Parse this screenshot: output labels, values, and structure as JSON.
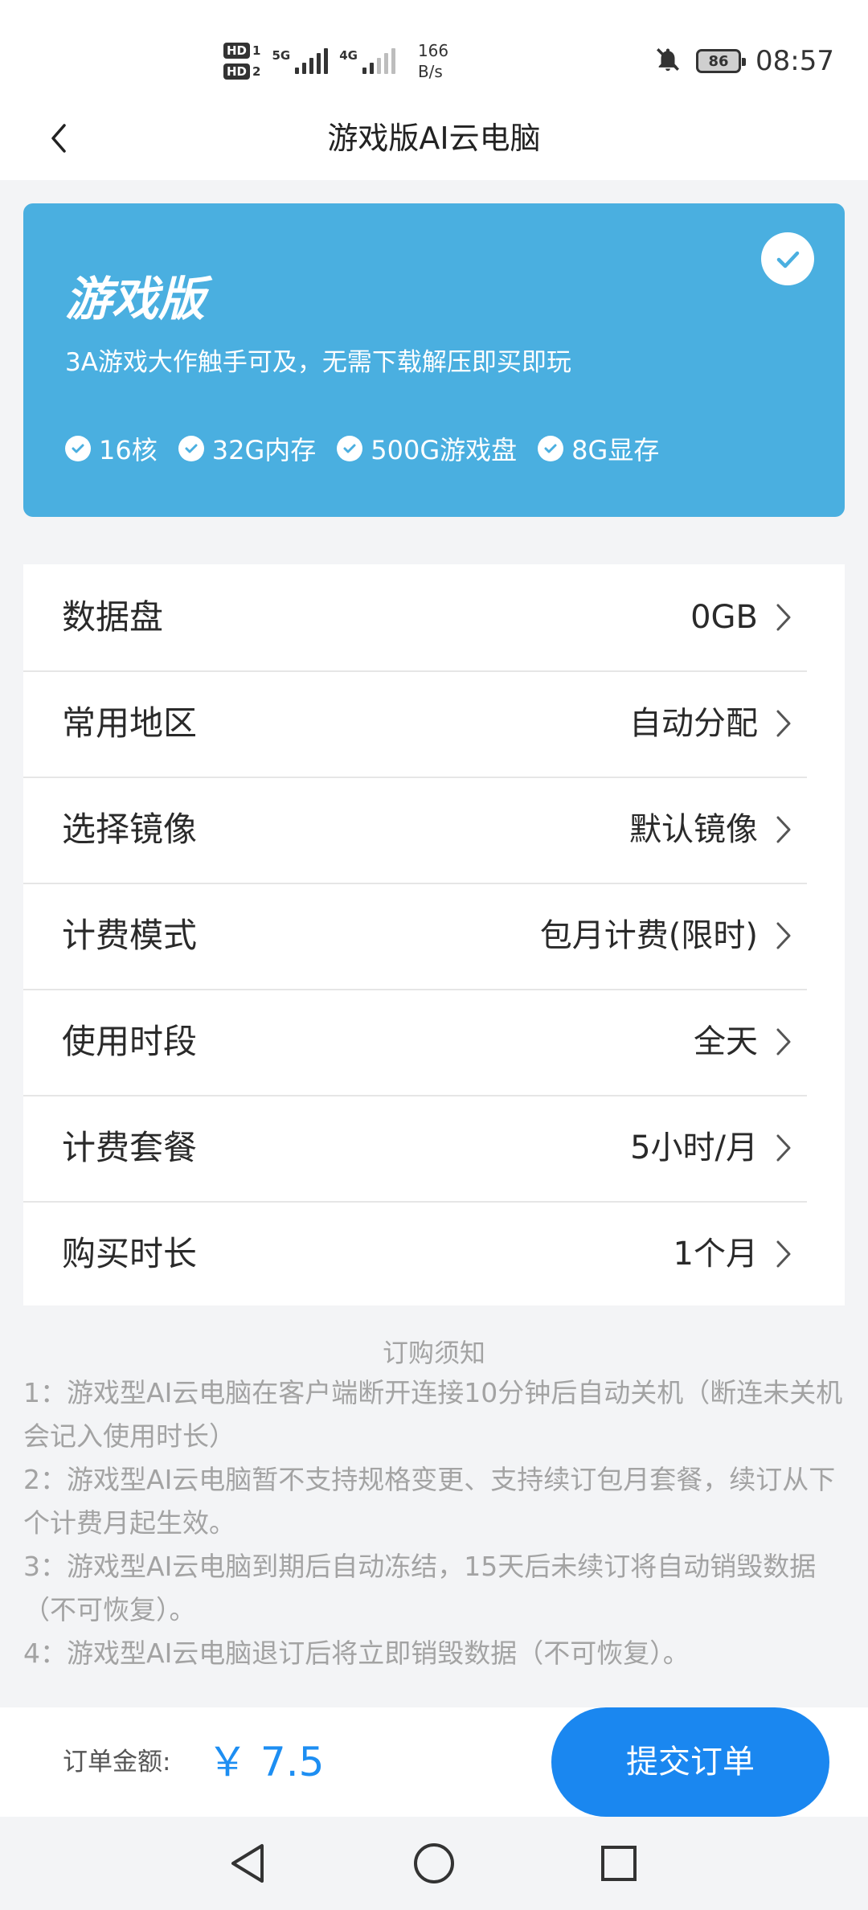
{
  "status_bar": {
    "hd1": "HD",
    "hd1_num": "1",
    "hd2": "HD",
    "hd2_num": "2",
    "sig1_label": "5G",
    "sig2_label": "4G",
    "net_speed_value": "166",
    "net_speed_unit": "B/s",
    "battery": "86",
    "time": "08:57",
    "icons": [
      "bell-off-icon",
      "battery-icon"
    ]
  },
  "header": {
    "back_icon": "chevron-left-icon",
    "title": "游戏版AI云电脑"
  },
  "plan": {
    "name": "游戏版",
    "description": "3A游戏大作触手可及，无需下载解压即买即玩",
    "selected": true,
    "features": [
      "16核",
      "32G内存",
      "500G游戏盘",
      "8G显存"
    ],
    "color": "#4aafe0"
  },
  "settings": [
    {
      "label": "数据盘",
      "value": "0GB"
    },
    {
      "label": "常用地区",
      "value": "自动分配"
    },
    {
      "label": "选择镜像",
      "value": "默认镜像"
    },
    {
      "label": "计费模式",
      "value": "包月计费(限时)"
    },
    {
      "label": "使用时段",
      "value": "全天"
    },
    {
      "label": "计费套餐",
      "value": "5小时/月"
    },
    {
      "label": "购买时长",
      "value": "1个月"
    }
  ],
  "notice": {
    "title": "订购须知",
    "items": [
      "1：游戏型AI云电脑在客户端断开连接10分钟后自动关机（断连未关机会记入使用时长）",
      "2：游戏型AI云电脑暂不支持规格变更、支持续订包月套餐，续订从下个计费月起生效。",
      "3：游戏型AI云电脑到期后自动冻结，15天后未续订将自动销毁数据（不可恢复）。",
      "4：游戏型AI云电脑退订后将立即销毁数据（不可恢复）。"
    ]
  },
  "order": {
    "amount_label": "订单金额:",
    "amount_value": "￥ 7.5",
    "submit_label": "提交订单",
    "accent_color": "#1a87f0"
  },
  "nav": {
    "icons": [
      "back-triangle-icon",
      "home-circle-icon",
      "recents-square-icon"
    ]
  }
}
